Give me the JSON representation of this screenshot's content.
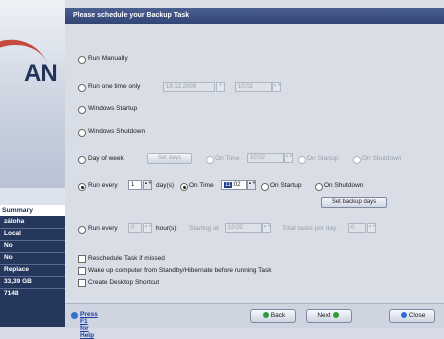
{
  "sidebar": {
    "logo_text": "AN",
    "summary_title": "Summary",
    "items": [
      "záloha",
      "Local",
      "No",
      "No",
      "Replace",
      "33,39 GB",
      "7148"
    ]
  },
  "title": "Please schedule your Backup Task",
  "options": {
    "run_manually": "Run Manually",
    "run_one_time": "Run one time only",
    "one_time_date": "19.12.2008",
    "one_time_time": "10:02",
    "windows_startup": "Windows Startup",
    "windows_shutdown": "Windows Shutdown",
    "day_of_week": "Day of week",
    "set_days": "Set days",
    "on_time": "On Time",
    "dow_time": "10:02",
    "on_startup": "On Startup",
    "on_shutdown": "On Shutdown",
    "run_every": "Run every",
    "days_value": "1",
    "days_unit": "day(s)",
    "days_time_hour": "11",
    "days_time_min": ":02",
    "set_backup_days": "Set backup days",
    "hours_value": "0",
    "hours_unit": "hour(s)",
    "starting_at": "Starting at",
    "hours_time": "10:02",
    "total_tasks_per_day": "Total tasks per day",
    "total_tasks_value": "0"
  },
  "checkboxes": {
    "reschedule": "Reschedule Task if missed",
    "wake_up": "Wake up computer from Standby/Hibernate before running Task",
    "desktop_shortcut": "Create Desktop Shortcut"
  },
  "footer": {
    "help": "Press F1 for Help",
    "back": "Back",
    "next": "Next",
    "close": "Close"
  },
  "colors": {
    "title_bar": "#324575",
    "sidebar_panel": "#26375d",
    "back_dot": "#2f9a3a",
    "next_dot": "#2f9a3a",
    "close_dot": "#2f6fd1"
  }
}
